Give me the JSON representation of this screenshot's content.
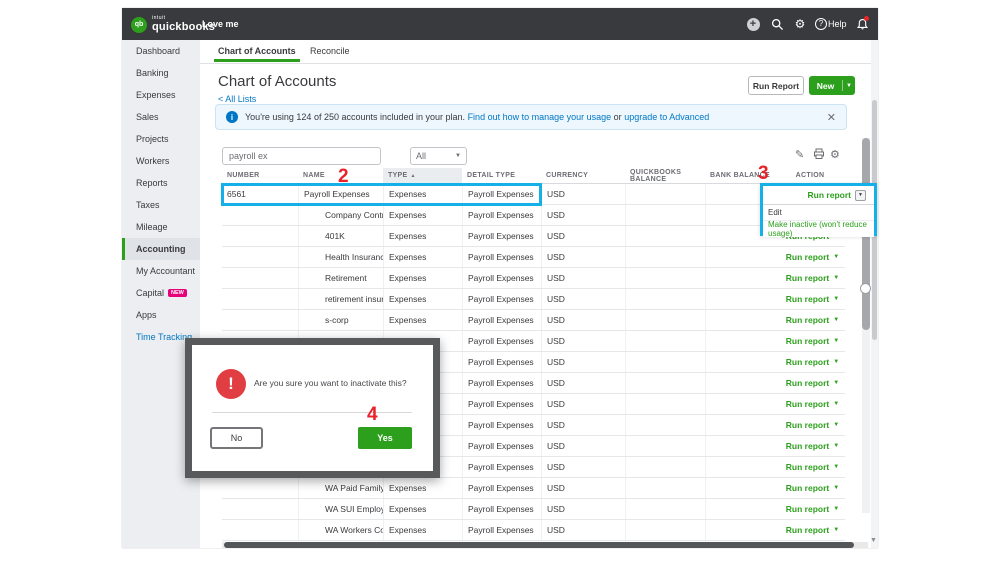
{
  "topbar": {
    "logo_circle": "qb",
    "logo_prefix": "intuit",
    "logo_text": "quickbooks",
    "company": "Love me",
    "help_label": "Help"
  },
  "sidebar": {
    "items": [
      {
        "label": "Dashboard"
      },
      {
        "label": "Banking"
      },
      {
        "label": "Expenses"
      },
      {
        "label": "Sales"
      },
      {
        "label": "Projects"
      },
      {
        "label": "Workers"
      },
      {
        "label": "Reports"
      },
      {
        "label": "Taxes"
      },
      {
        "label": "Mileage"
      },
      {
        "label": "Accounting",
        "active": true
      },
      {
        "label": "My Accountant"
      },
      {
        "label": "Capital",
        "badge": "NEW"
      },
      {
        "label": "Apps"
      },
      {
        "label": "Time Tracking",
        "highlight": true
      }
    ]
  },
  "tabs": [
    {
      "label": "Chart of Accounts",
      "active": true
    },
    {
      "label": "Reconcile"
    }
  ],
  "header": {
    "title": "Chart of Accounts",
    "back_link": "All Lists",
    "run_report_button": "Run Report",
    "new_button": "New"
  },
  "banner": {
    "text": "You're using 124 of 250 accounts included in your plan.",
    "link1": "Find out how to manage your usage",
    "mid": "or",
    "link2": "upgrade to Advanced"
  },
  "filters": {
    "search_value": "payroll ex",
    "type_filter": "All"
  },
  "table": {
    "columns": [
      "NUMBER",
      "NAME",
      "TYPE",
      "DETAIL TYPE",
      "CURRENCY",
      "QUICKBOOKS BALANCE",
      "BANK BALANCE",
      "ACTION"
    ],
    "sort_column": "TYPE",
    "action_label": "Run report",
    "rows": [
      {
        "number": "6561",
        "name": "Payroll Expenses",
        "type": "Expenses",
        "detail": "Payroll Expenses",
        "currency": "USD",
        "sub": false,
        "highlighted": true
      },
      {
        "number": "",
        "name": "Company Contributions",
        "type": "Expenses",
        "detail": "Payroll Expenses",
        "currency": "USD",
        "sub": true
      },
      {
        "number": "",
        "name": "401K",
        "type": "Expenses",
        "detail": "Payroll Expenses",
        "currency": "USD",
        "sub": true
      },
      {
        "number": "",
        "name": "Health Insurance",
        "type": "Expenses",
        "detail": "Payroll Expenses",
        "currency": "USD",
        "sub": true
      },
      {
        "number": "",
        "name": "Retirement",
        "type": "Expenses",
        "detail": "Payroll Expenses",
        "currency": "USD",
        "sub": true
      },
      {
        "number": "",
        "name": "retirement insurance",
        "type": "Expenses",
        "detail": "Payroll Expenses",
        "currency": "USD",
        "sub": true
      },
      {
        "number": "",
        "name": "s-corp",
        "type": "Expenses",
        "detail": "Payroll Expenses",
        "currency": "USD",
        "sub": true
      },
      {
        "number": "",
        "name": "",
        "type": "",
        "detail": "Payroll Expenses",
        "currency": "USD",
        "sub": true
      },
      {
        "number": "",
        "name": "",
        "type": "",
        "detail": "Payroll Expenses",
        "currency": "USD",
        "sub": true
      },
      {
        "number": "",
        "name": "",
        "type": "",
        "detail": "Payroll Expenses",
        "currency": "USD",
        "sub": true
      },
      {
        "number": "",
        "name": "",
        "type": "",
        "detail": "Payroll Expenses",
        "currency": "USD",
        "sub": true
      },
      {
        "number": "",
        "name": "",
        "type": "",
        "detail": "Payroll Expenses",
        "currency": "USD",
        "sub": true
      },
      {
        "number": "",
        "name": "",
        "type": "",
        "detail": "Payroll Expenses",
        "currency": "USD",
        "sub": true
      },
      {
        "number": "",
        "name": "",
        "type": "",
        "detail": "Payroll Expenses",
        "currency": "USD",
        "sub": true
      },
      {
        "number": "",
        "name": "WA Paid Family and",
        "type": "Expenses",
        "detail": "Payroll Expenses",
        "currency": "USD",
        "sub": true
      },
      {
        "number": "",
        "name": "WA SUI Employer",
        "type": "Expenses",
        "detail": "Payroll Expenses",
        "currency": "USD",
        "sub": true
      },
      {
        "number": "",
        "name": "WA Workers Compe",
        "type": "Expenses",
        "detail": "Payroll Expenses",
        "currency": "USD",
        "sub": true
      }
    ]
  },
  "context_menu": {
    "items": [
      {
        "label": "Edit"
      },
      {
        "label": "Make inactive (won't reduce usage)",
        "green": true
      }
    ]
  },
  "dialog": {
    "message": "Are you sure you want to inactivate this?",
    "no_label": "No",
    "yes_label": "Yes"
  },
  "annotations": {
    "step2": "2",
    "step3": "3",
    "step4": "4"
  },
  "colors": {
    "accent_green": "#2ca01c",
    "link_blue": "#0077c5",
    "annotation_cyan": "#16b0e8",
    "annotation_red": "#e8212a",
    "topbar_dark": "#393a3d",
    "dialog_frame": "#58595b",
    "warning_red": "#e03e42"
  }
}
